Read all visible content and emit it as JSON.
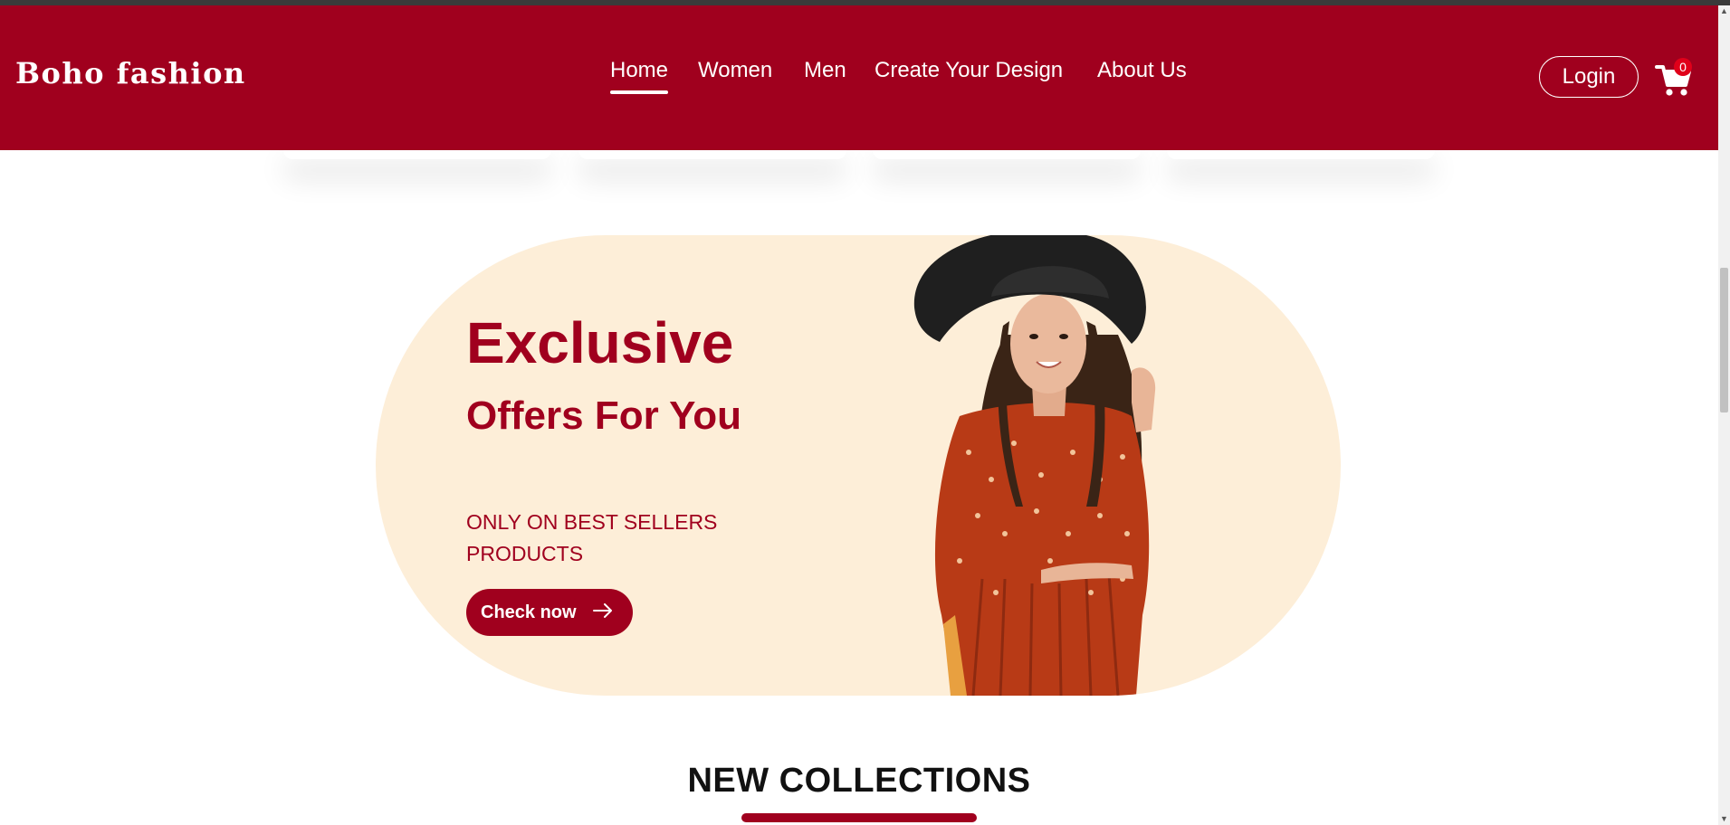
{
  "brand": {
    "name": "Boho fashion"
  },
  "nav": {
    "items": [
      {
        "label": "Home",
        "active": true
      },
      {
        "label": "Women",
        "active": false
      },
      {
        "label": "Men",
        "active": false
      },
      {
        "label": "Create Your Design",
        "active": false
      },
      {
        "label": "About Us",
        "active": false
      }
    ]
  },
  "header": {
    "login_label": "Login",
    "cart_count": "0"
  },
  "hero": {
    "title": "Exclusive",
    "subtitle": "Offers For You",
    "description": "ONLY ON BEST SELLERS PRODUCTS",
    "cta_label": "Check now"
  },
  "sections": {
    "new_collections_title": "NEW COLLECTIONS"
  },
  "colors": {
    "brand": "#a0001e",
    "hero_bg": "#fdeed8",
    "badge": "#e0001a"
  },
  "icons": [
    "cart-icon",
    "arrow-right-icon"
  ]
}
